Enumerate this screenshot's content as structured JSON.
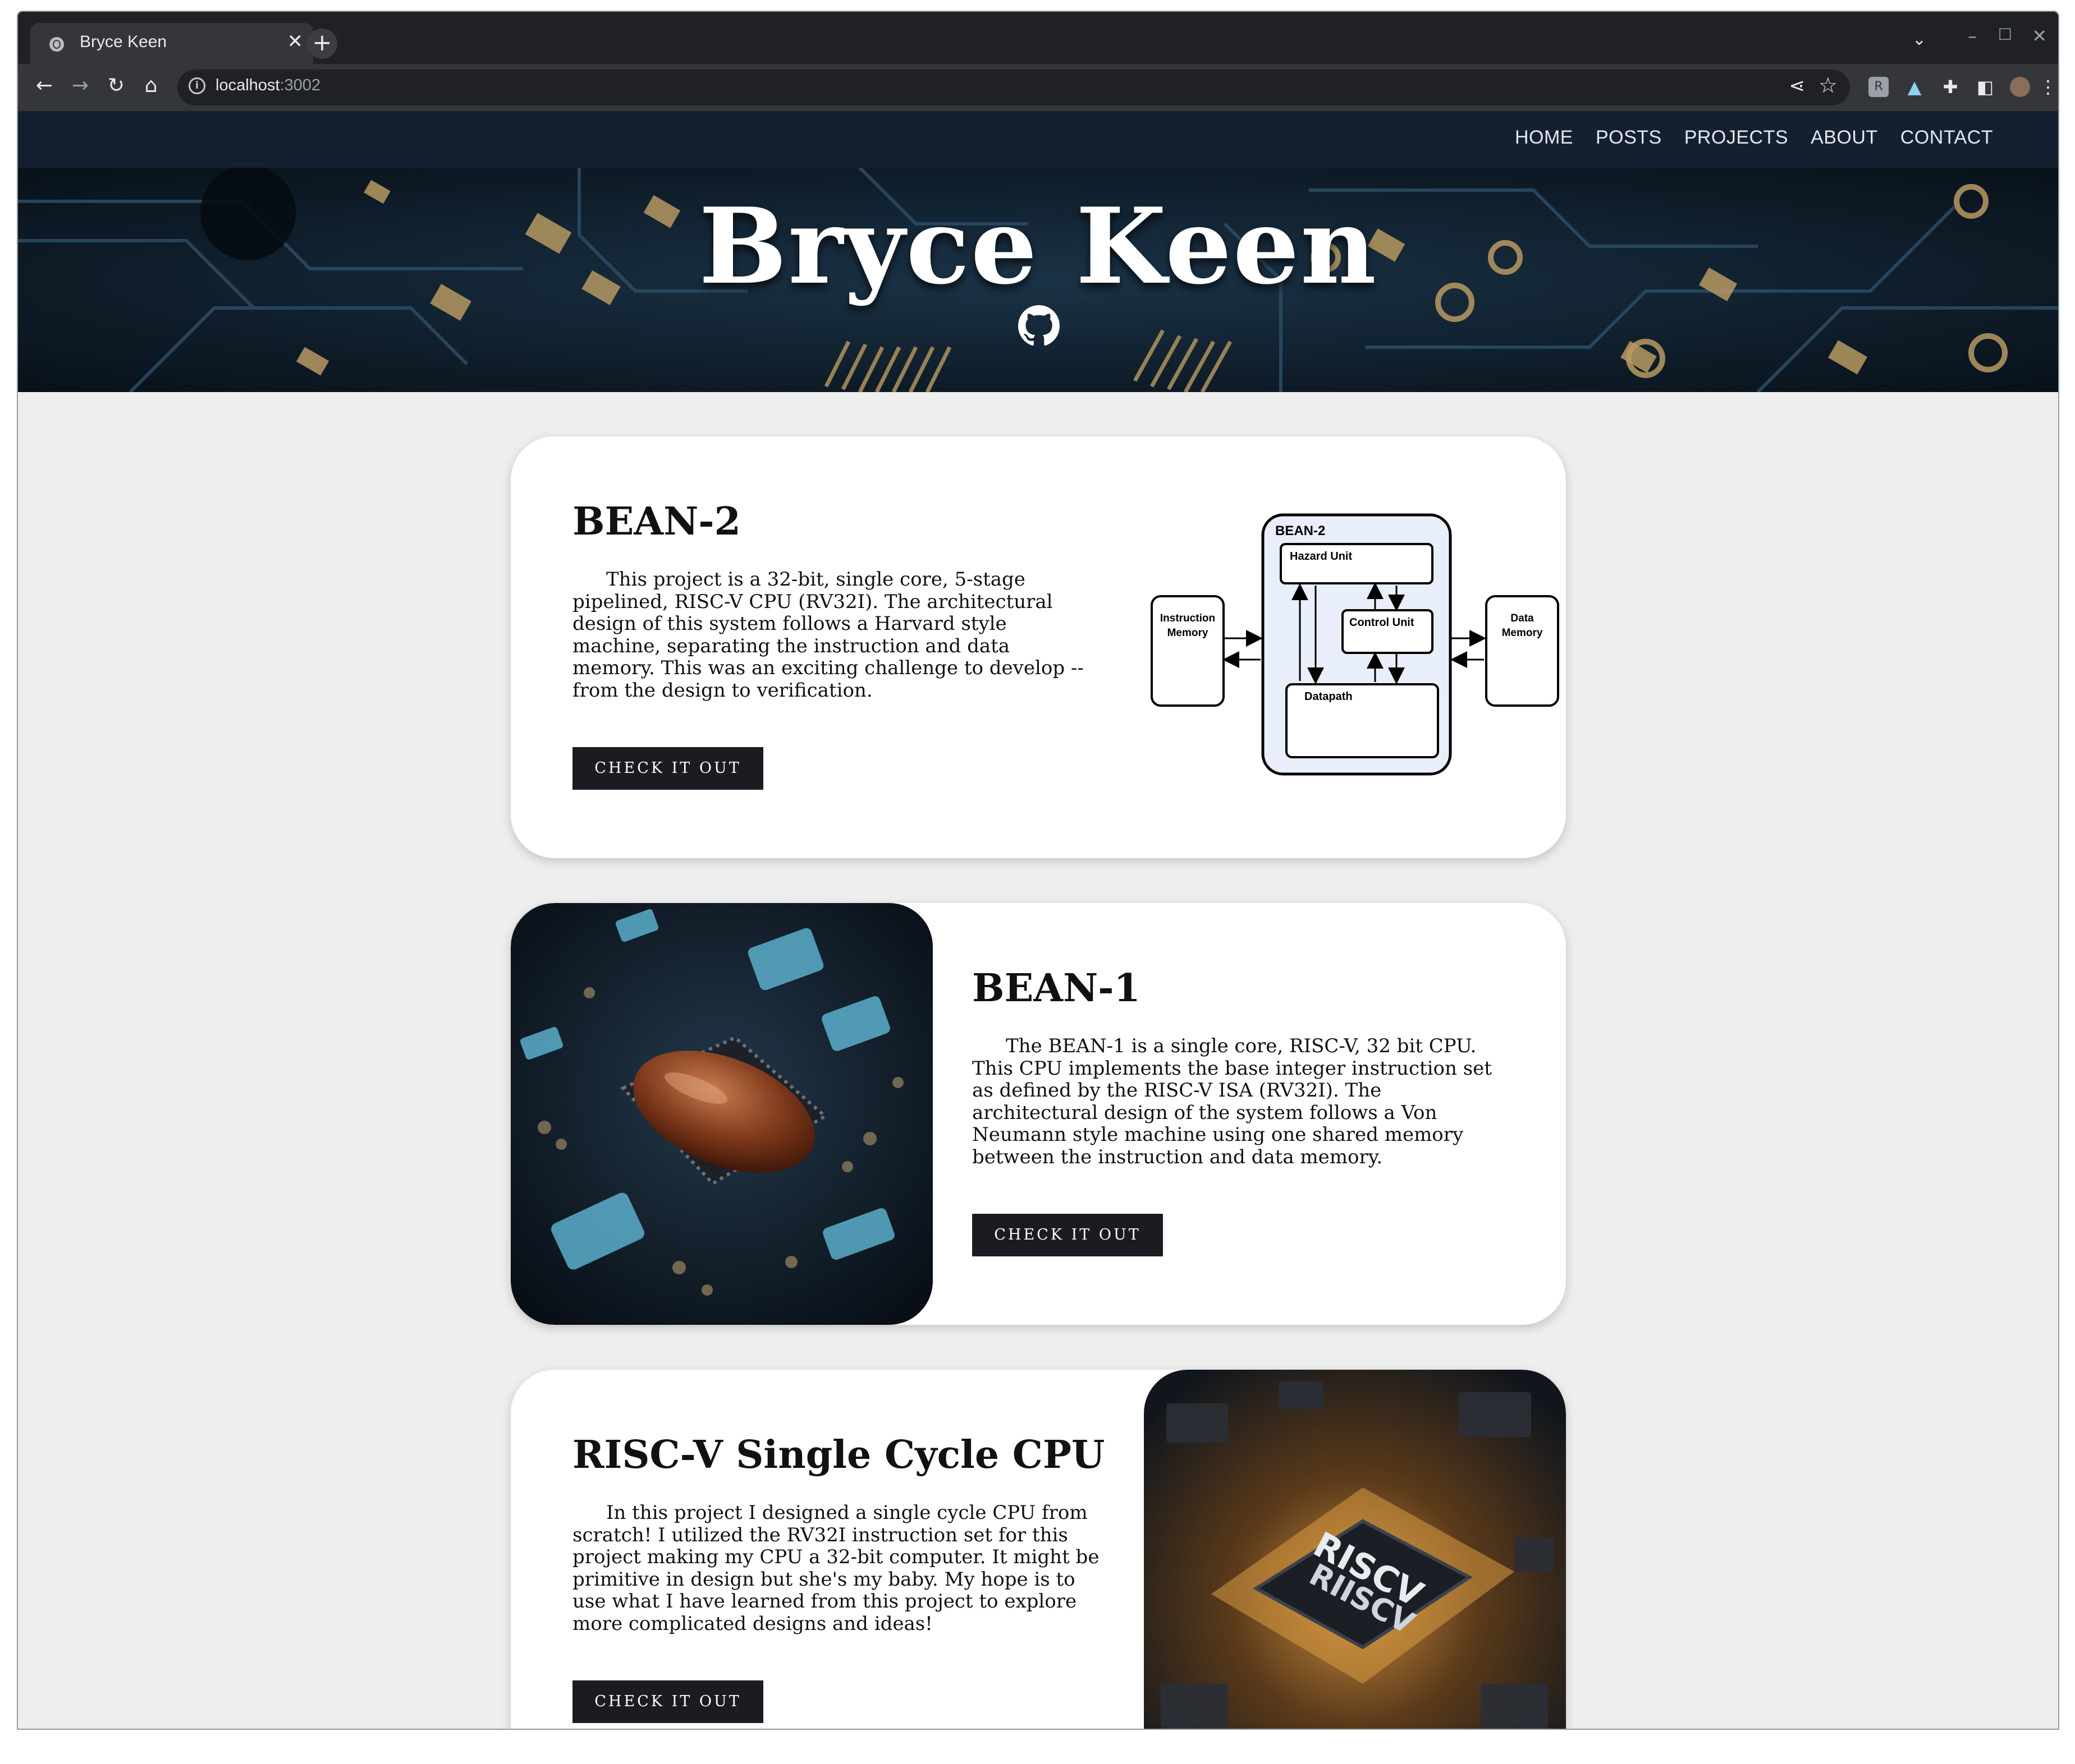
{
  "browser": {
    "tab_title": "Bryce Keen",
    "tab_close": "✕",
    "new_tab": "+",
    "url_host": "localhost",
    "url_port": ":3002"
  },
  "nav": {
    "items": [
      "HOME",
      "POSTS",
      "PROJECTS",
      "ABOUT",
      "CONTACT"
    ]
  },
  "hero": {
    "title": "Bryce Keen",
    "icon": "github-icon"
  },
  "projects": [
    {
      "title": "BEAN-2",
      "description": "This project is a 32-bit, single core, 5-stage pipelined, RISC-V CPU (RV32I). The architectural design of this system follows a Harvard style machine, separating the instruction and data memory. This was an exciting challenge to develop -- from the design to verification.",
      "button": "CHECK IT OUT",
      "diagram": {
        "title": "BEAN-2",
        "hazard": "Hazard Unit",
        "control": "Control Unit",
        "datapath": "Datapath",
        "imem_line1": "Instruction",
        "imem_line2": "Memory",
        "dmem_line1": "Data",
        "dmem_line2": "Memory"
      }
    },
    {
      "title": "BEAN-1",
      "description": "The BEAN-1 is a single core, RISC-V, 32 bit CPU. This CPU implements the base integer instruction set as defined by the RISC-V ISA (RV32I). The architectural design of the system follows a Von Neumann style machine using one shared memory between the instruction and data memory.",
      "button": "CHECK IT OUT"
    },
    {
      "title": "RISC-V Single Cycle CPU",
      "description": "In this project I designed a single cycle CPU from scratch! I utilized the RV32I instruction set for this project making my CPU a 32-bit computer. It might be primitive in design but she's my baby. My hope is to use what I have learned from this project to explore more complicated designs and ideas!",
      "button": "CHECK IT OUT",
      "chip_label_1": "RISCV",
      "chip_label_2": "RIISCV"
    }
  ],
  "colors": {
    "nav_bg": "#142030",
    "page_bg": "#eeeeee",
    "button_bg": "#1a1c22"
  }
}
